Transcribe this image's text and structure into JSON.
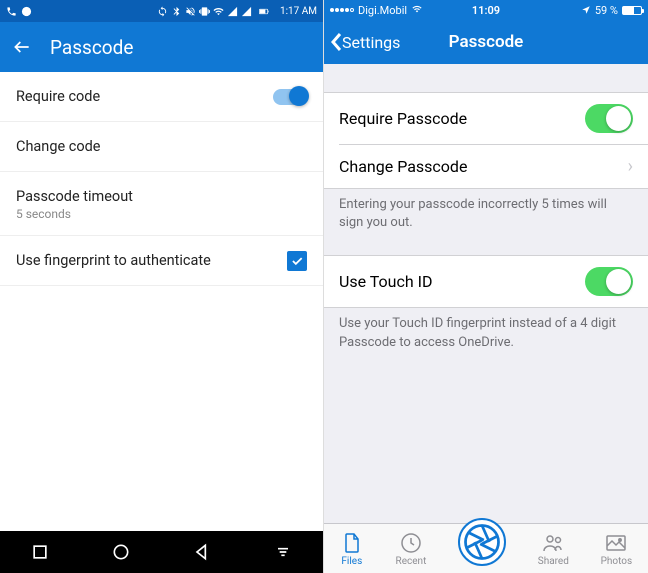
{
  "android": {
    "status": {
      "time": "1:17 AM"
    },
    "header": {
      "title": "Passcode"
    },
    "rows": {
      "require": "Require code",
      "change": "Change code",
      "timeout_label": "Passcode timeout",
      "timeout_value": "5 seconds",
      "fingerprint": "Use fingerprint to authenticate"
    }
  },
  "ios": {
    "status": {
      "carrier": "Digi.Mobil",
      "time": "11:09",
      "battery": "59 %"
    },
    "header": {
      "back": "Settings",
      "title": "Passcode"
    },
    "rows": {
      "require": "Require Passcode",
      "change": "Change Passcode",
      "touchid": "Use Touch ID"
    },
    "footers": {
      "lockout": "Entering your passcode incorrectly 5 times will sign you out.",
      "touchid": "Use your Touch ID fingerprint instead of a 4 digit Passcode to access OneDrive."
    },
    "tabs": {
      "files": "Files",
      "recent": "Recent",
      "shared": "Shared",
      "photos": "Photos"
    }
  }
}
